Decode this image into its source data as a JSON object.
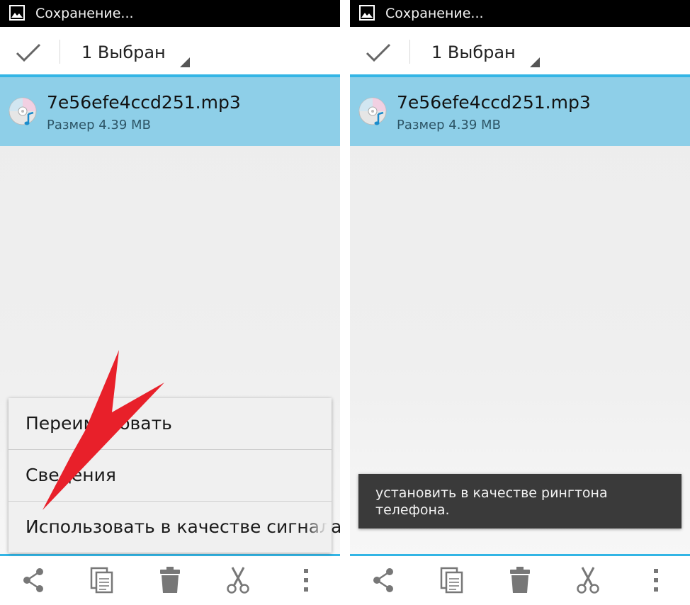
{
  "screens": [
    {
      "status_title": "Сохранение...",
      "selection_label": "1 Выбран",
      "file": {
        "name": "7e56efe4ccd251.mp3",
        "size": "Размер 4.39 MB"
      },
      "popup_menu": [
        "Переименовать",
        "Сведения",
        "Использовать в качестве сигнала"
      ]
    },
    {
      "status_title": "Сохранение...",
      "selection_label": "1 Выбран",
      "file": {
        "name": "7e56efe4ccd251.mp3",
        "size": "Размер 4.39 MB"
      },
      "toast": "установить в качестве рингтона телефона."
    }
  ],
  "toolbar_icons": [
    "share-icon",
    "copy-icon",
    "delete-icon",
    "cut-icon",
    "overflow-menu-icon"
  ],
  "colors": {
    "accent_blue": "#33b5e5",
    "selected_row": "#8ecfe8",
    "annotation_arrow": "#e8202a",
    "toast_bg": "#3a3a3a"
  }
}
